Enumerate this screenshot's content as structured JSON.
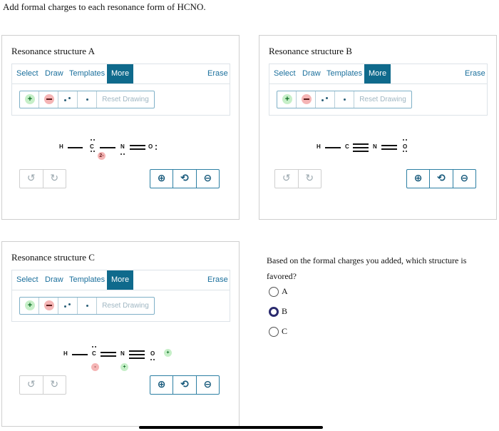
{
  "prompt": "Add formal charges to each resonance form of HCNO.",
  "toolbar": {
    "select": "Select",
    "draw": "Draw",
    "templates": "Templates",
    "more": "More",
    "erase": "Erase",
    "reset": "Reset Drawing",
    "plus": "+"
  },
  "controls": {
    "undo": "↺",
    "redo": "↻",
    "zoom_in": "⊕",
    "zoom_reset": "⟲",
    "zoom_out": "⊖"
  },
  "panels": [
    {
      "title": "Resonance structure A",
      "atoms": {
        "h": "H",
        "c": "C",
        "n": "N",
        "o": "O"
      },
      "charge_c": "2-"
    },
    {
      "title": "Resonance structure B",
      "atoms": {
        "h": "H",
        "c": "C",
        "n": "N",
        "o": "O"
      }
    },
    {
      "title": "Resonance structure C",
      "atoms": {
        "h": "H",
        "c": "C",
        "n": "N",
        "o": "O"
      },
      "charge_c": "-",
      "charge_n": "+",
      "charge_o": "+"
    }
  ],
  "question": {
    "text": "Based on the formal charges you added, which structure is favored?",
    "options": [
      "A",
      "B",
      "C"
    ],
    "selected": "B"
  }
}
